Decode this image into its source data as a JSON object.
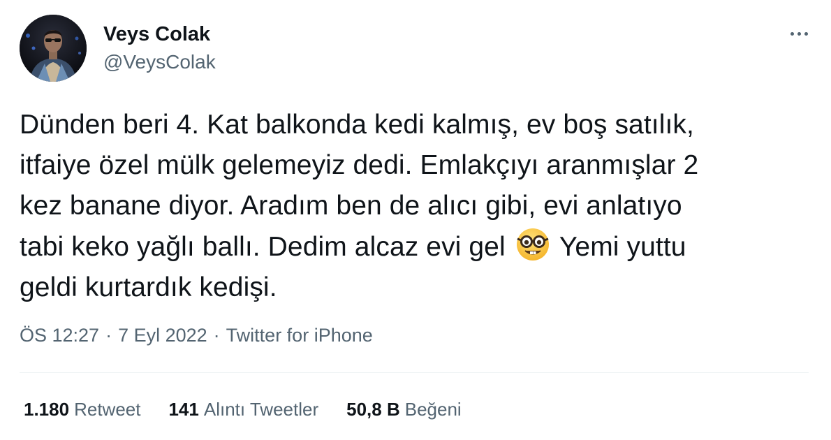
{
  "author": {
    "display_name": "Veys Colak",
    "handle": "@VeysColak",
    "avatar_icon": "profile-photo"
  },
  "more_menu": {
    "icon": "more-horizontal-icon"
  },
  "tweet": {
    "text_before_emoji": "Dünden beri 4. Kat balkonda kedi kalmış, ev boş satılık,\nitfaiye özel mülk gelemeyiz dedi. Emlakçıyı aranmışlar 2\nkez banane diyor. Aradım ben de alıcı gibi, evi anlatıyo\ntabi keko yağlı ballı. Dedim alcaz evi gel ",
    "emoji": "nerd-face-emoji",
    "text_after_emoji": " Yemi yuttu\ngeldi kurtardık kedişi."
  },
  "meta": {
    "time": "ÖS 12:27",
    "separator": "·",
    "date": "7 Eyl 2022",
    "source": "Twitter for iPhone"
  },
  "stats": {
    "retweets": {
      "count": "1.180",
      "label": "Retweet"
    },
    "quotes": {
      "count": "141",
      "label": "Alıntı Tweetler"
    },
    "likes": {
      "count": "50,8 B",
      "label": "Beğeni"
    }
  },
  "colors": {
    "text_primary": "#0f1419",
    "text_secondary": "#536471",
    "divider": "#eff3f4"
  }
}
